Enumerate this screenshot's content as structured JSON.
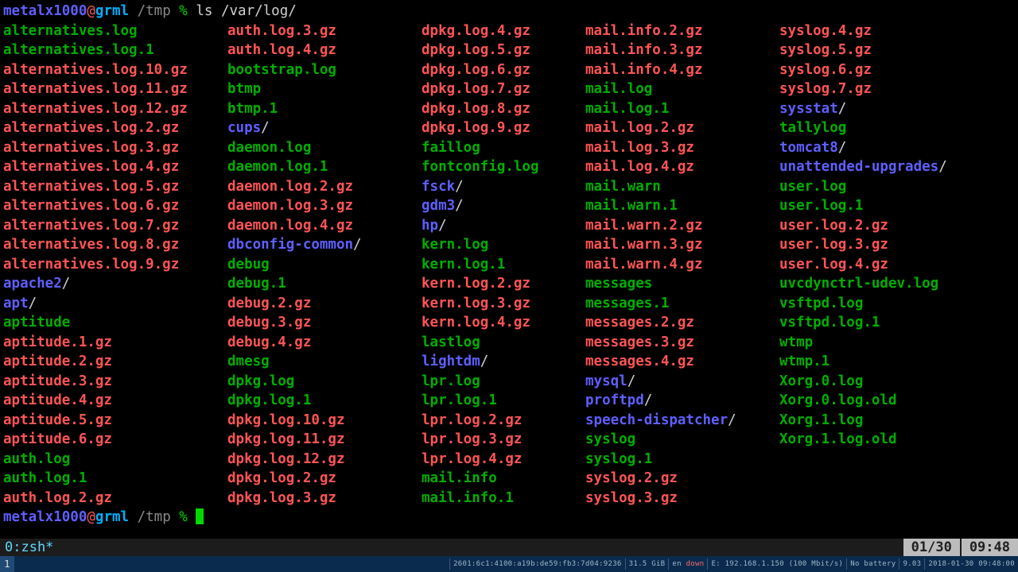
{
  "prompt": {
    "user": "metalx1000",
    "at": "@",
    "host": "grml",
    "cwd": " /tmp ",
    "pct": "% ",
    "cmd": "ls /var/log/"
  },
  "columns": [
    [
      {
        "t": "alternatives.log",
        "c": "log"
      },
      {
        "t": "alternatives.log.1",
        "c": "log"
      },
      {
        "t": "alternatives.log.10.gz",
        "c": "gz"
      },
      {
        "t": "alternatives.log.11.gz",
        "c": "gz"
      },
      {
        "t": "alternatives.log.12.gz",
        "c": "gz"
      },
      {
        "t": "alternatives.log.2.gz",
        "c": "gz"
      },
      {
        "t": "alternatives.log.3.gz",
        "c": "gz"
      },
      {
        "t": "alternatives.log.4.gz",
        "c": "gz"
      },
      {
        "t": "alternatives.log.5.gz",
        "c": "gz"
      },
      {
        "t": "alternatives.log.6.gz",
        "c": "gz"
      },
      {
        "t": "alternatives.log.7.gz",
        "c": "gz"
      },
      {
        "t": "alternatives.log.8.gz",
        "c": "gz"
      },
      {
        "t": "alternatives.log.9.gz",
        "c": "gz"
      },
      {
        "t": "apache2",
        "c": "dir",
        "s": "/"
      },
      {
        "t": "apt",
        "c": "dir",
        "s": "/"
      },
      {
        "t": "aptitude",
        "c": "log"
      },
      {
        "t": "aptitude.1.gz",
        "c": "gz"
      },
      {
        "t": "aptitude.2.gz",
        "c": "gz"
      },
      {
        "t": "aptitude.3.gz",
        "c": "gz"
      },
      {
        "t": "aptitude.4.gz",
        "c": "gz"
      },
      {
        "t": "aptitude.5.gz",
        "c": "gz"
      },
      {
        "t": "aptitude.6.gz",
        "c": "gz"
      },
      {
        "t": "auth.log",
        "c": "log"
      },
      {
        "t": "auth.log.1",
        "c": "log"
      },
      {
        "t": "auth.log.2.gz",
        "c": "gz"
      }
    ],
    [
      {
        "t": "auth.log.3.gz",
        "c": "gz"
      },
      {
        "t": "auth.log.4.gz",
        "c": "gz"
      },
      {
        "t": "bootstrap.log",
        "c": "log"
      },
      {
        "t": "btmp",
        "c": "log"
      },
      {
        "t": "btmp.1",
        "c": "log"
      },
      {
        "t": "cups",
        "c": "dir",
        "s": "/"
      },
      {
        "t": "daemon.log",
        "c": "log"
      },
      {
        "t": "daemon.log.1",
        "c": "log"
      },
      {
        "t": "daemon.log.2.gz",
        "c": "gz"
      },
      {
        "t": "daemon.log.3.gz",
        "c": "gz"
      },
      {
        "t": "daemon.log.4.gz",
        "c": "gz"
      },
      {
        "t": "dbconfig-common",
        "c": "dir",
        "s": "/"
      },
      {
        "t": "debug",
        "c": "log"
      },
      {
        "t": "debug.1",
        "c": "log"
      },
      {
        "t": "debug.2.gz",
        "c": "gz"
      },
      {
        "t": "debug.3.gz",
        "c": "gz"
      },
      {
        "t": "debug.4.gz",
        "c": "gz"
      },
      {
        "t": "dmesg",
        "c": "log"
      },
      {
        "t": "dpkg.log",
        "c": "log"
      },
      {
        "t": "dpkg.log.1",
        "c": "log"
      },
      {
        "t": "dpkg.log.10.gz",
        "c": "gz"
      },
      {
        "t": "dpkg.log.11.gz",
        "c": "gz"
      },
      {
        "t": "dpkg.log.12.gz",
        "c": "gz"
      },
      {
        "t": "dpkg.log.2.gz",
        "c": "gz"
      },
      {
        "t": "dpkg.log.3.gz",
        "c": "gz"
      }
    ],
    [
      {
        "t": "dpkg.log.4.gz",
        "c": "gz"
      },
      {
        "t": "dpkg.log.5.gz",
        "c": "gz"
      },
      {
        "t": "dpkg.log.6.gz",
        "c": "gz"
      },
      {
        "t": "dpkg.log.7.gz",
        "c": "gz"
      },
      {
        "t": "dpkg.log.8.gz",
        "c": "gz"
      },
      {
        "t": "dpkg.log.9.gz",
        "c": "gz"
      },
      {
        "t": "faillog",
        "c": "log"
      },
      {
        "t": "fontconfig.log",
        "c": "log"
      },
      {
        "t": "fsck",
        "c": "dir",
        "s": "/"
      },
      {
        "t": "gdm3",
        "c": "dir",
        "s": "/"
      },
      {
        "t": "hp",
        "c": "dir",
        "s": "/"
      },
      {
        "t": "kern.log",
        "c": "log"
      },
      {
        "t": "kern.log.1",
        "c": "log"
      },
      {
        "t": "kern.log.2.gz",
        "c": "gz"
      },
      {
        "t": "kern.log.3.gz",
        "c": "gz"
      },
      {
        "t": "kern.log.4.gz",
        "c": "gz"
      },
      {
        "t": "lastlog",
        "c": "log"
      },
      {
        "t": "lightdm",
        "c": "dir",
        "s": "/"
      },
      {
        "t": "lpr.log",
        "c": "log"
      },
      {
        "t": "lpr.log.1",
        "c": "log"
      },
      {
        "t": "lpr.log.2.gz",
        "c": "gz"
      },
      {
        "t": "lpr.log.3.gz",
        "c": "gz"
      },
      {
        "t": "lpr.log.4.gz",
        "c": "gz"
      },
      {
        "t": "mail.info",
        "c": "log"
      },
      {
        "t": "mail.info.1",
        "c": "log"
      }
    ],
    [
      {
        "t": "mail.info.2.gz",
        "c": "gz"
      },
      {
        "t": "mail.info.3.gz",
        "c": "gz"
      },
      {
        "t": "mail.info.4.gz",
        "c": "gz"
      },
      {
        "t": "mail.log",
        "c": "log"
      },
      {
        "t": "mail.log.1",
        "c": "log"
      },
      {
        "t": "mail.log.2.gz",
        "c": "gz"
      },
      {
        "t": "mail.log.3.gz",
        "c": "gz"
      },
      {
        "t": "mail.log.4.gz",
        "c": "gz"
      },
      {
        "t": "mail.warn",
        "c": "log"
      },
      {
        "t": "mail.warn.1",
        "c": "log"
      },
      {
        "t": "mail.warn.2.gz",
        "c": "gz"
      },
      {
        "t": "mail.warn.3.gz",
        "c": "gz"
      },
      {
        "t": "mail.warn.4.gz",
        "c": "gz"
      },
      {
        "t": "messages",
        "c": "log"
      },
      {
        "t": "messages.1",
        "c": "log"
      },
      {
        "t": "messages.2.gz",
        "c": "gz"
      },
      {
        "t": "messages.3.gz",
        "c": "gz"
      },
      {
        "t": "messages.4.gz",
        "c": "gz"
      },
      {
        "t": "mysql",
        "c": "dir",
        "s": "/"
      },
      {
        "t": "proftpd",
        "c": "dir",
        "s": "/"
      },
      {
        "t": "speech-dispatcher",
        "c": "dir",
        "s": "/"
      },
      {
        "t": "syslog",
        "c": "log"
      },
      {
        "t": "syslog.1",
        "c": "log"
      },
      {
        "t": "syslog.2.gz",
        "c": "gz"
      },
      {
        "t": "syslog.3.gz",
        "c": "gz"
      }
    ],
    [
      {
        "t": "syslog.4.gz",
        "c": "gz"
      },
      {
        "t": "syslog.5.gz",
        "c": "gz"
      },
      {
        "t": "syslog.6.gz",
        "c": "gz"
      },
      {
        "t": "syslog.7.gz",
        "c": "gz"
      },
      {
        "t": "sysstat",
        "c": "dir",
        "s": "/"
      },
      {
        "t": "tallylog",
        "c": "log"
      },
      {
        "t": "tomcat8",
        "c": "dir",
        "s": "/"
      },
      {
        "t": "unattended-upgrades",
        "c": "dir",
        "s": "/"
      },
      {
        "t": "user.log",
        "c": "log"
      },
      {
        "t": "user.log.1",
        "c": "log"
      },
      {
        "t": "user.log.2.gz",
        "c": "gz"
      },
      {
        "t": "user.log.3.gz",
        "c": "gz"
      },
      {
        "t": "user.log.4.gz",
        "c": "gz"
      },
      {
        "t": "uvcdynctrl-udev.log",
        "c": "log"
      },
      {
        "t": "vsftpd.log",
        "c": "log"
      },
      {
        "t": "vsftpd.log.1",
        "c": "log"
      },
      {
        "t": "wtmp",
        "c": "log"
      },
      {
        "t": "wtmp.1",
        "c": "log"
      },
      {
        "t": "Xorg.0.log",
        "c": "log"
      },
      {
        "t": "Xorg.0.log.old",
        "c": "log"
      },
      {
        "t": "Xorg.1.log",
        "c": "log"
      },
      {
        "t": "Xorg.1.log.old",
        "c": "log"
      }
    ]
  ],
  "status": {
    "left": "0:zsh*",
    "right1": "01/30",
    "right2": "09:48"
  },
  "bottom": {
    "ws": "1",
    "ipv6": "2601:6c1:4100:a19b:de59:fb3:7d04:9236",
    "disk": "31.5 GiB",
    "eth_lbl": "en",
    "eth_state": "down",
    "eth": "E: 192.168.1.150 (100 Mbit/s)",
    "batt": "No battery",
    "load": "9.03",
    "date": "2018-01-30 09:48:00"
  }
}
